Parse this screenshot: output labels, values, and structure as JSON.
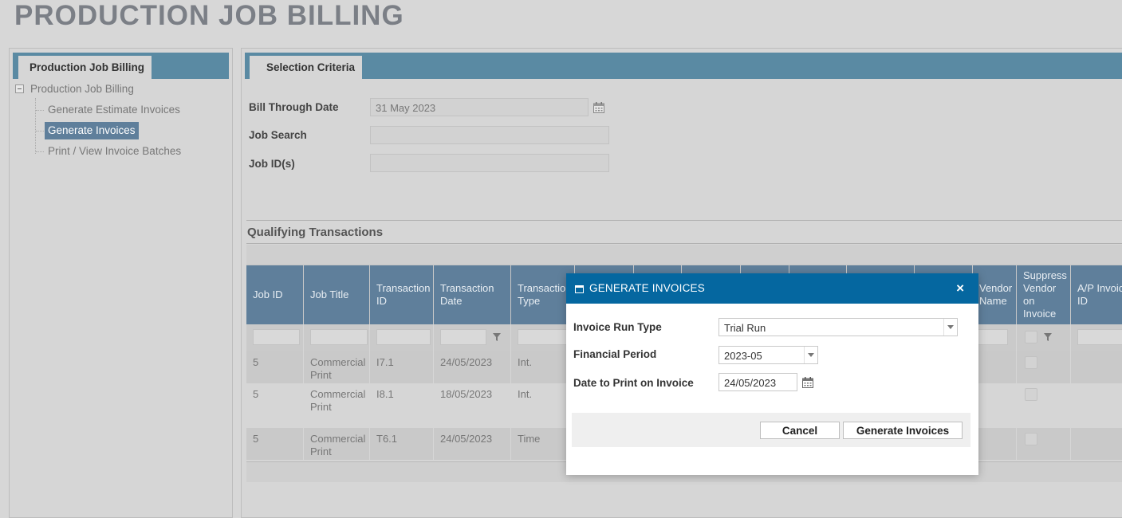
{
  "page": {
    "title": "PRODUCTION JOB BILLING"
  },
  "left_panel": {
    "tab_label": "Production Job Billing",
    "tree": {
      "root_label": "Production Job Billing",
      "items": [
        {
          "label": "Generate Estimate Invoices",
          "selected": false
        },
        {
          "label": "Generate Invoices",
          "selected": true
        },
        {
          "label": "Print / View Invoice Batches",
          "selected": false
        }
      ]
    }
  },
  "selection_criteria": {
    "tab_label": "Selection Criteria",
    "bill_through_date": {
      "label": "Bill Through Date",
      "value": "31 May 2023"
    },
    "job_search": {
      "label": "Job Search",
      "value": ""
    },
    "job_ids": {
      "label": "Job ID(s)",
      "value": ""
    }
  },
  "qualifying_transactions": {
    "title": "Qualifying Transactions",
    "columns": [
      "Job ID",
      "Job Title",
      "Transaction ID",
      "Transaction Date",
      "Transaction Type",
      "",
      "",
      "",
      "",
      "",
      "",
      "",
      "Vendor Name",
      "Suppress Vendor on Invoice",
      "A/P Invoice ID"
    ],
    "rows": [
      {
        "job_id": "5",
        "job_title": "Commercial Print",
        "transaction_id": "I7.1",
        "transaction_date": "24/05/2023",
        "transaction_type": "Int."
      },
      {
        "job_id": "5",
        "job_title": "Commercial Print",
        "transaction_id": "I8.1",
        "transaction_date": "18/05/2023",
        "transaction_type": "Int."
      },
      {
        "job_id": "5",
        "job_title": "Commercial Print",
        "transaction_id": "T6.1",
        "transaction_date": "24/05/2023",
        "transaction_type": "Time"
      }
    ]
  },
  "modal": {
    "title": "GENERATE INVOICES",
    "close_glyph": "×",
    "invoice_run_type": {
      "label": "Invoice Run Type",
      "value": "Trial Run"
    },
    "financial_period": {
      "label": "Financial Period",
      "value": "2023-05"
    },
    "date_to_print": {
      "label": "Date to Print on Invoice",
      "value": "24/05/2023"
    },
    "cancel_label": "Cancel",
    "generate_label": "Generate Invoices"
  },
  "icons": {
    "calendar": "calendar-icon",
    "filter": "filter-icon",
    "tree_collapse": "tree-collapse-icon",
    "window": "window-icon",
    "close": "close-icon"
  },
  "colors": {
    "tab_bar": "#5a8aa3",
    "grid_header": "#5f7f9b",
    "modal_header": "#0567a0",
    "selected_item": "#5f7f9b"
  }
}
